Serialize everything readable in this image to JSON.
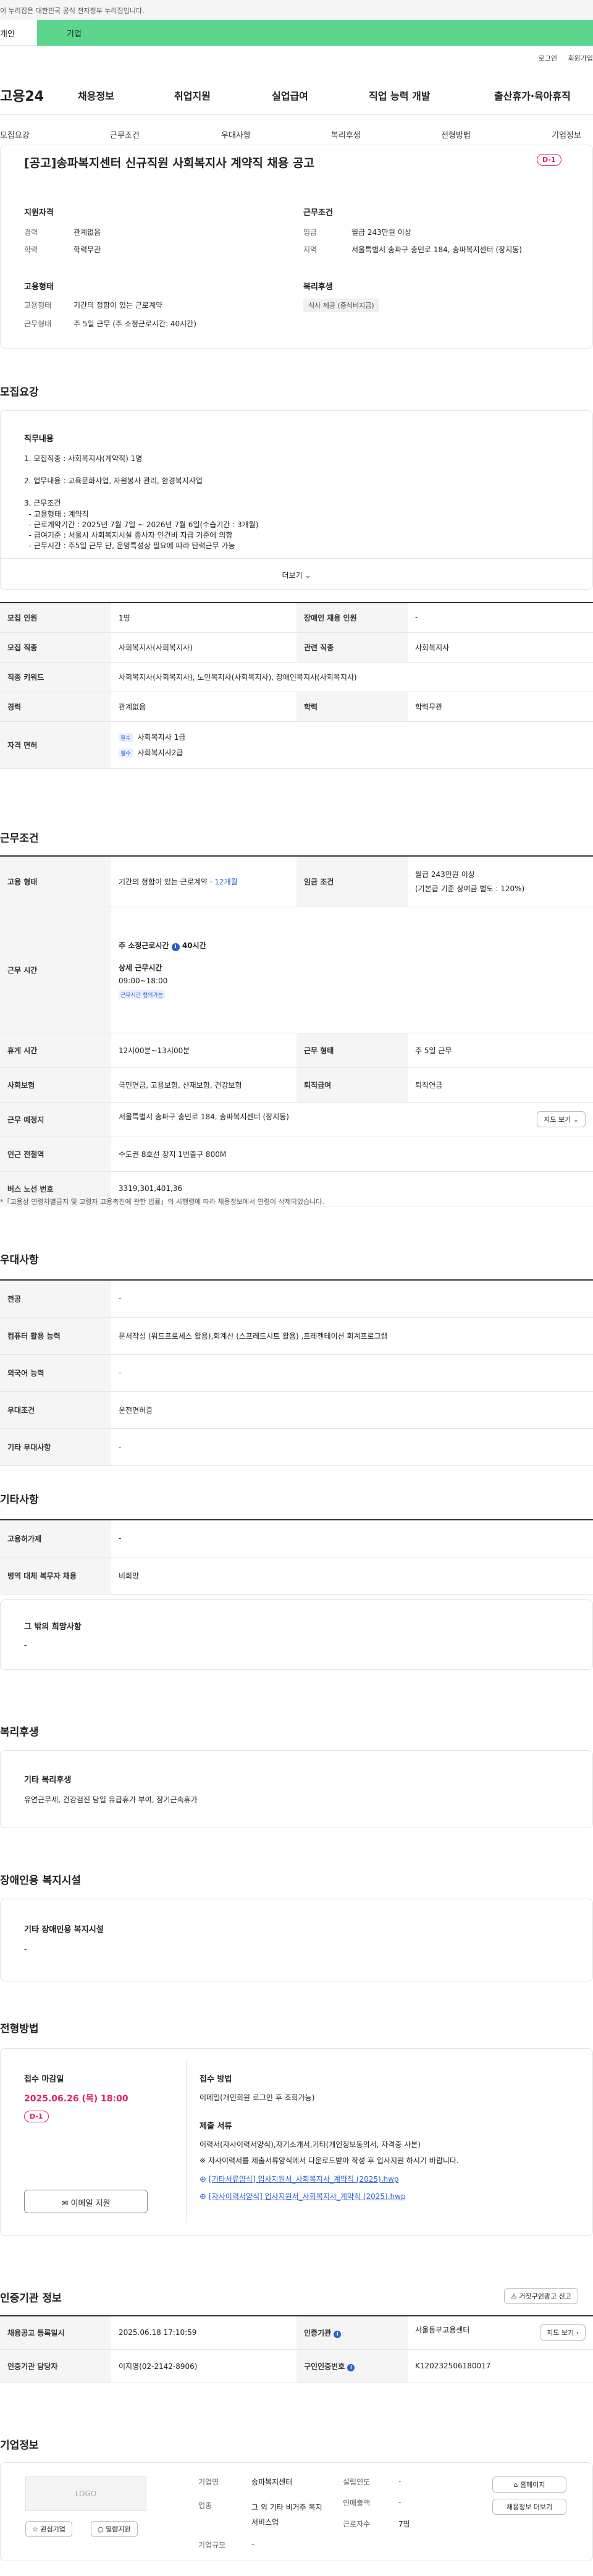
{
  "notice": {
    "text": "이 누리집은 대한민국 공식 전자정부 누리집입니다."
  },
  "topbar": {
    "left": "개인",
    "right": "기업"
  },
  "util": {
    "login": "로그인",
    "join": "회원가입"
  },
  "gnb": {
    "logo": "고용24",
    "menus": [
      "채용정보",
      "취업지원",
      "실업급여",
      "직업 능력 개발",
      "출산휴가·육아휴직"
    ]
  },
  "subtabs": [
    "모집요강",
    "근무조건",
    "우대사항",
    "복리후생",
    "전형방법",
    "기업정보"
  ],
  "header": {
    "title": "[공고]송파복지센터 신규직원 사회복지사 계약직 채용 공고",
    "dday": "D-1",
    "qual_h": "지원자격",
    "exp_l": "경력",
    "exp_v": "관계없음",
    "edu_l": "학력",
    "edu_v": "학력무관",
    "cond_h": "근무조건",
    "pay_l": "임금",
    "pay_v": "월급 243만원 이상",
    "loc_l": "지역",
    "loc_v": "서울특별시 송파구 충민로 184, 송파복지센터 (장지동)",
    "emp_h": "고용형태",
    "type_l": "고용형태",
    "type_v": "기간의 정함이 있는 근로계약",
    "form_l": "근무형태",
    "form_v": "주 5일 근무 (주 소정근로시간: 40시간)",
    "wel_h": "복리후생",
    "wel_chip": "식사 제공 (중식비지급)"
  },
  "recruit": {
    "heading": "모집요강",
    "job_h": "직무내용",
    "lines": [
      "1. 모집직종 : 사회복지사(계약직) 1명",
      "2. 업무내용 : 교육문화사업, 자원봉사 관리, 환경복지사업",
      "3. 근무조건",
      "  - 고용형태 : 계약직",
      "  - 근로계약기간 : 2025년 7월 7일 ~ 2026년 7월 6일(수습기간 : 3개월)",
      "  - 급여기준 : 서울시 사회복지시설 종사자 인건비 지급 기준에 의함",
      "  - 근무시간 : 주5일 근무 단, 운영특성상 필요에 따라 탄력근무 가능"
    ],
    "more": "더보기",
    "rows": {
      "cnt_l": "모집 인원",
      "cnt_v": "1명",
      "dis_l": "장애인 채용 인원",
      "dis_v": "-",
      "job_l": "모집 직종",
      "job_v": "사회복지사(사회복지사)",
      "rel_l": "관련 직종",
      "rel_v": "사회복지사",
      "kw_l": "직종 키워드",
      "kw_v": "사회복지사(사회복지사), 노인복지사(사회복지사), 장애인복지사(사회복지사)",
      "exp_l": "경력",
      "exp_v": "관계없음",
      "edu_l": "학력",
      "edu_v": "학력무관",
      "lic_l": "자격 면허",
      "req": "필수",
      "lic1": "사회복지사 1급",
      "lic2": "사회복지사2급"
    }
  },
  "conditions": {
    "heading": "근무조건",
    "emp_l": "고용 형태",
    "emp_v": "기간의 정함이 있는 근로계약 · ",
    "emp_months": "12개월",
    "pay_l": "임금 조건",
    "pay_v": "월급 243만원 이상",
    "pay_sub": "(기본급 기준 상여금 별도 : 120%)",
    "hours_l": "근무 시간",
    "hours_h": "주 소정근로시간",
    "hours_v": "40시간",
    "detail_h": "상세 근무시간",
    "detail_v": "09:00~18:00",
    "flex": "근무시간 협의가능",
    "rest_l": "휴게 시간",
    "rest_v": "12시00분~13시00분",
    "form_l": "근무 형태",
    "form_v": "주 5일 근무",
    "ins_l": "사회보험",
    "ins_v": "국민연금, 고용보험, 산재보험, 건강보험",
    "ret_l": "퇴직급여",
    "ret_v": "퇴직연금",
    "addr_l": "근무 예정지",
    "addr_v": "서울특별시 송파구 충민로 184, 송파복지센터 (장지동)",
    "map_btn": "지도 보기",
    "sub_l": "인근 전철역",
    "sub_v": "수도권 8호선 장지 1번출구 800M",
    "bus_l": "버스 노선 번호",
    "bus_v": "3319,301,401,36",
    "note": "*「고용상 연령차별금지 및 고령자 고용촉진에 관한 법률」의 시행령에 따라 채용정보에서 연령이 삭제되었습니다."
  },
  "pref": {
    "heading": "우대사항",
    "major_l": "전공",
    "major_v": "-",
    "pc_l": "컴퓨터 활용 능력",
    "pc_v": "문서작성 (워드프로세스 활용),회계산 (스프레드시트 활용) ,프레젠테이션 회계프로그램",
    "lang_l": "외국어 능력",
    "lang_v": "-",
    "pref_l": "우대조건",
    "pref_v": "운전면허증",
    "etc_l": "기타 우대사항",
    "etc_v": "-"
  },
  "other": {
    "heading": "기타사항",
    "hire_l": "고용허가제",
    "hire_v": "-",
    "mil_l": "병역 대체 복무자 채용",
    "mil_v": "비희망",
    "wish_h": "그 밖의 희망사항",
    "wish_v": "-"
  },
  "welfare": {
    "heading": "복리후생",
    "h": "기타 복리후생",
    "v": "유연근무제, 건강검진 당일 유급휴가 부여, 장기근속휴가"
  },
  "disabled": {
    "heading": "장애인용 복지시설",
    "h": "기타 장애인용 복지시설",
    "v": "-"
  },
  "process": {
    "heading": "전형방법",
    "deadline_h": "접수 마감일",
    "deadline_v": "2025.06.26 (목) 18:00",
    "dday": "D-1",
    "email_btn": "이메일 지원",
    "method_h": "접수 방법",
    "method_v": "이메일(개인회원 로그인 후 조회가능)",
    "docs_h": "제출 서류",
    "docs_v": "이력서(자사이력서양식),자기소개서,기타(개인정보동의서, 자격증 사본)",
    "docs_note": "※ 자사이력서를 제출서류양식에서 다운로드받아 작성 후 입사지원 하시기 바랍니다.",
    "file1": "[기타서류양식] 입사지원서_사회복지사_계약직 (2025).hwp",
    "file2": "[자사이력서양식] 입사지원서_사회복지사_계약직 (2025).hwp"
  },
  "cert": {
    "heading": "인증기관 정보",
    "report_btn": "거짓구인광고 신고",
    "reg_l": "채용공고 등록일시",
    "reg_v": "2025.06.18 17:10:59",
    "org_l": "인증기관",
    "org_v": "서울동부고용센터",
    "map_btn": "지도 보기",
    "mgr_l": "인증기관 담당자",
    "mgr_v": "이지영(02-2142-8906)",
    "no_l": "구인인증번호",
    "no_v": "K120232506180017"
  },
  "company": {
    "heading": "기업정보",
    "logo": "LOGO",
    "fav_btn": "관심기업",
    "rec_btn": "열람지원",
    "name_l": "기업명",
    "name_v": "송파복지센터",
    "ind_l": "업종",
    "ind_v": "그 외 기타 비거주 복지 서비스업",
    "size_l": "기업규모",
    "size_v": "-",
    "year_l": "설립연도",
    "year_v": "-",
    "sales_l": "연매출액",
    "sales_v": "-",
    "emp_l": "근로자수",
    "emp_v": "7명",
    "home_btn": "홈페이지",
    "jobs_btn": "채용정보 더보기"
  }
}
